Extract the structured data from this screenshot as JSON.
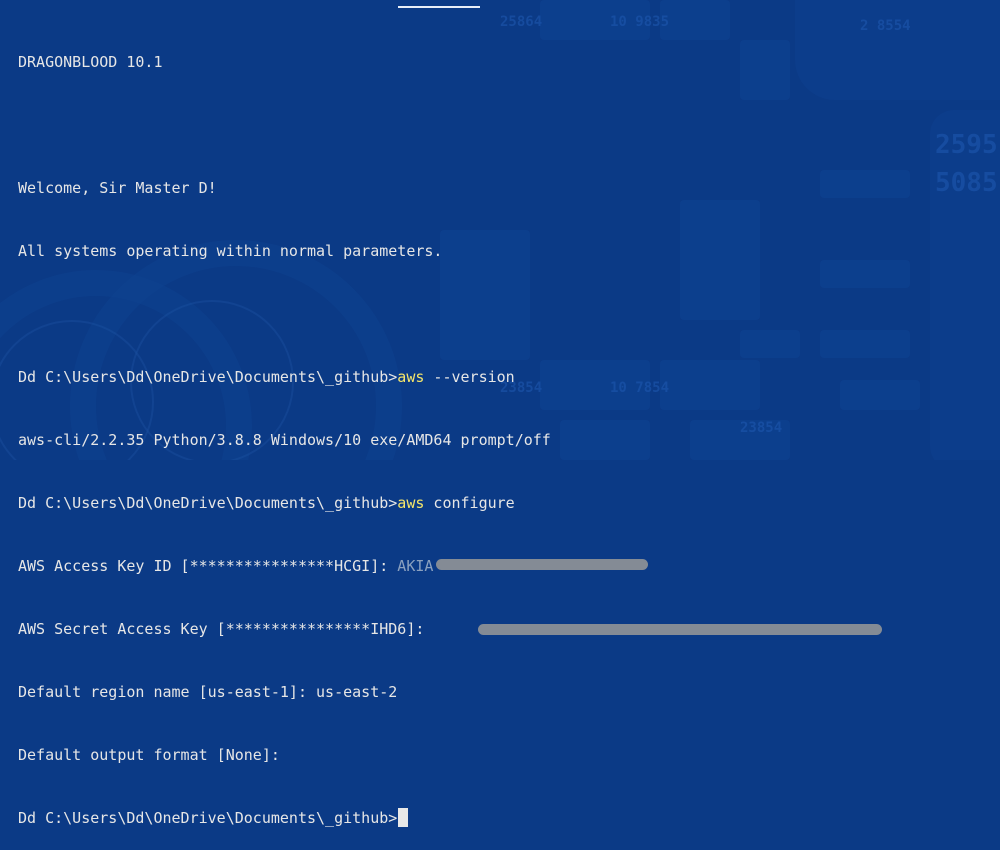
{
  "terminal": {
    "banner": "DRAGONBLOOD 10.1",
    "welcome": "Welcome, Sir Master D!",
    "status": "All systems operating within normal parameters.",
    "prompt": "Dd C:\\Users\\Dd\\OneDrive\\Documents\\_github>",
    "cmd1": "aws",
    "cmd1_args": " --version",
    "version_output": "aws-cli/2.2.35 Python/3.8.8 Windows/10 exe/AMD64 prompt/off",
    "cmd2": "aws",
    "cmd2_args": " configure",
    "access_key_label": "AWS Access Key ID [****************HCGI]: ",
    "access_key_value": "AKIA",
    "secret_key_label": "AWS Secret Access Key [****************IHD6]: ",
    "secret_key_value": "",
    "region_label": "Default region name [us-east-1]: ",
    "region_value": "us-east-2",
    "output_label": "Default output format [None]: ",
    "output_value": ""
  },
  "colors": {
    "background": "#0b3a86",
    "text": "#e6e6e6",
    "command": "#f5e66a",
    "redaction": "#8b8f96"
  }
}
